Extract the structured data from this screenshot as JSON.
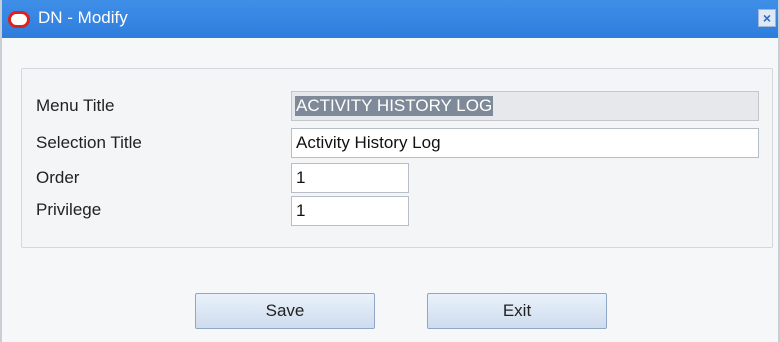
{
  "window": {
    "title": "DN - Modify",
    "close_glyph": "×"
  },
  "form": {
    "menu_title": {
      "label": "Menu Title",
      "value": "ACTIVITY HISTORY LOG"
    },
    "selection_title": {
      "label": "Selection Title",
      "value": "Activity History Log"
    },
    "order": {
      "label": "Order",
      "value": "1"
    },
    "privilege": {
      "label": "Privilege",
      "value": "1"
    }
  },
  "buttons": {
    "save": "Save",
    "exit": "Exit"
  },
  "colors": {
    "titlebar": "#2e7ddd",
    "logo_red": "#e0201b",
    "selection_highlight": "#7e8a99"
  },
  "icons": {
    "app_logo": "oracle-logo-icon",
    "close": "close-icon"
  }
}
